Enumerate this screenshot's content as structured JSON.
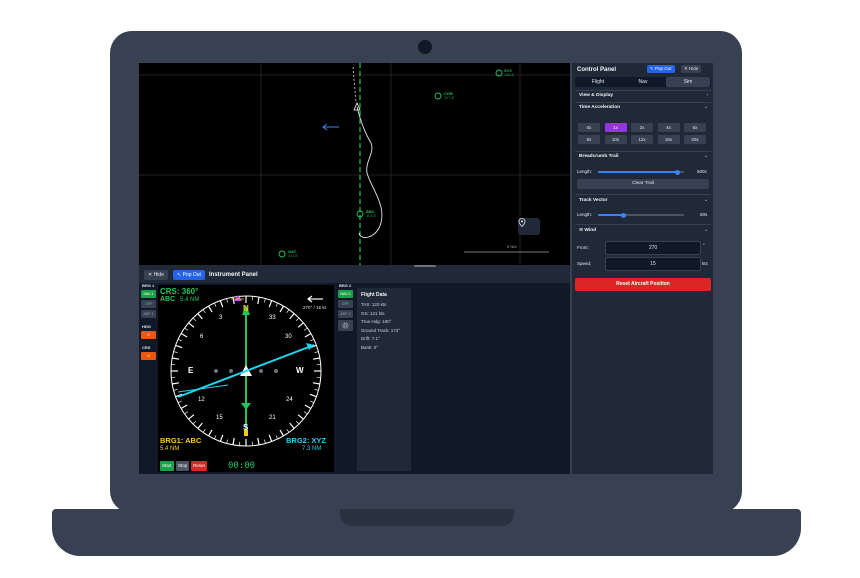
{
  "map": {
    "waypoints": [
      {
        "name": "XYZ",
        "freq": "115.6"
      },
      {
        "name": "COR",
        "freq": "117.8"
      },
      {
        "name": "ABC",
        "freq": "113.5"
      },
      {
        "name": "GAT",
        "freq": "111.8"
      }
    ],
    "scale_label": "5 NM"
  },
  "instrument_panel": {
    "hide_label": "✕ Hide",
    "popout_label": "↖ Pop Out",
    "title": "Instrument Panel",
    "brg1": {
      "label": "BRG 1",
      "buttons": [
        "NAV 1",
        "OFF",
        "ADF 1"
      ]
    },
    "hdg": {
      "label": "HDG",
      "button": "↺"
    },
    "crs": {
      "label": "CRS",
      "button": "↺"
    },
    "brg2": {
      "label": "BRG 2",
      "buttons": [
        "NAV 2",
        "OFF",
        "ADF 2"
      ]
    },
    "hsi": {
      "crs_text": "CRS: 360°",
      "crs_station": "ABC",
      "crs_distance": "5.4 NM",
      "wind_text": "270° / 15 kt",
      "brg1_text": "BRG1: ABC",
      "brg1_distance": "5.4 NM",
      "brg2_text": "BRG2: XYZ",
      "brg2_distance": "7.3 NM",
      "cardinals": {
        "n": "N",
        "e": "E",
        "s": "S",
        "w": "W"
      },
      "numbers": {
        "n3": "3",
        "n6": "6",
        "n12": "12",
        "n15": "15",
        "n21": "21",
        "n24": "24",
        "n30": "30",
        "n33": "33"
      }
    },
    "timer": {
      "start": "Start",
      "stop": "Stop",
      "reset": "Reset",
      "value": "00:00"
    },
    "flight_data": {
      "title": "Flight Data",
      "rows": [
        "TAS: 120 kts",
        "GS: 121 kts",
        "True Hdg: 180°",
        "Ground Track: 173°",
        "Drift: 7.1°",
        "Bank: 0°"
      ]
    }
  },
  "control_panel": {
    "title": "Control Panel",
    "popout_label": "↖ Pop Out",
    "hide_label": "✕ Hide",
    "tabs": [
      "Flight",
      "Nav",
      "Sim"
    ],
    "view_display": "View & Display",
    "time_acceleration": {
      "title": "Time Acceleration",
      "options": [
        "0x",
        "1x",
        "2x",
        "4x",
        "6x",
        "8x",
        "10x",
        "12x",
        "16x",
        "20x"
      ],
      "selected": "1x"
    },
    "breadcrumb": {
      "title": "Breadcrumb Trail",
      "length_label": "Length:",
      "length_value": "600s",
      "length_fraction": 0.92,
      "clear_label": "Clear Trail"
    },
    "track_vector": {
      "title": "Track Vector",
      "length_label": "Length:",
      "length_value": "60s",
      "length_fraction": 0.3
    },
    "wind": {
      "title": "Wind",
      "from_label": "From:",
      "from_value": "270",
      "from_unit": "°",
      "speed_label": "Speed:",
      "speed_value": "15",
      "speed_unit": "kts"
    },
    "reset_label": "Reset Aircraft Position"
  },
  "colors": {
    "accent": "#2563eb",
    "nav_green": "#16a34a",
    "purple": "#9333ea",
    "danger": "#dc2626",
    "cyan": "#22d3ee",
    "yellow": "#facc15"
  }
}
